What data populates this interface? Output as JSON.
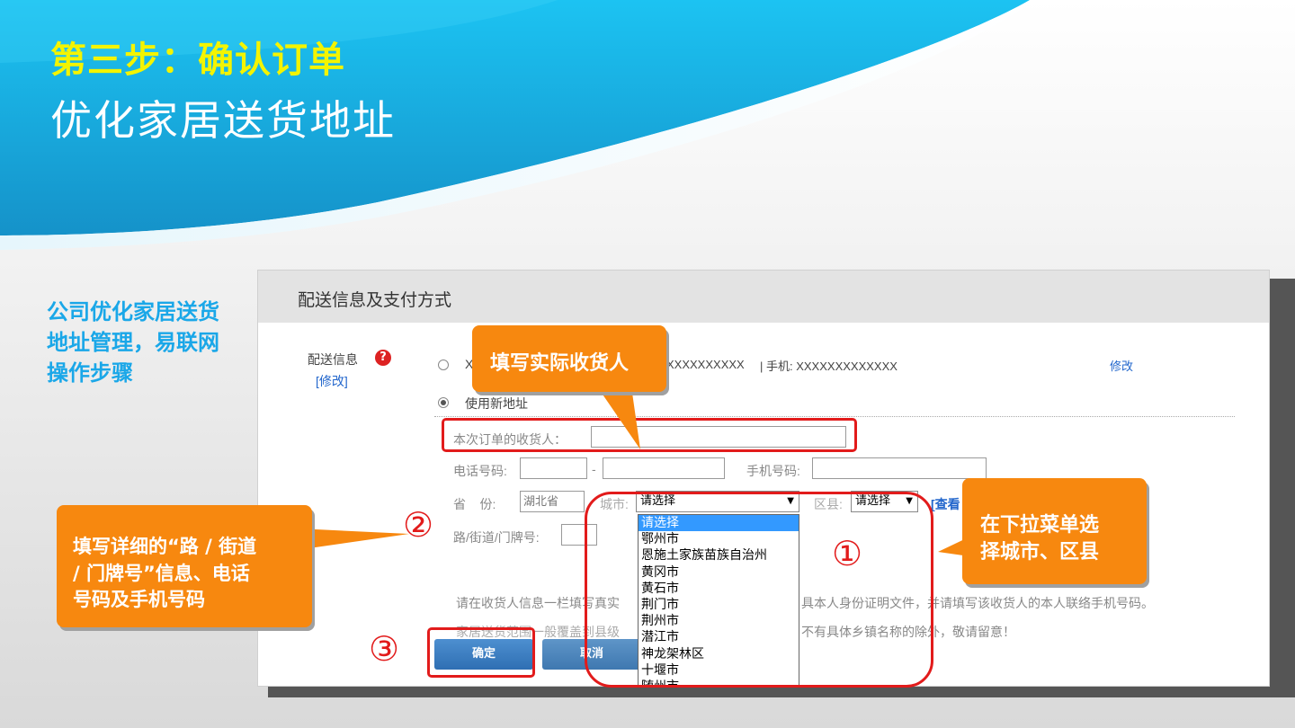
{
  "slide": {
    "step_title": "第三步：确认订单",
    "main_title": "优化家居送货地址",
    "side_note": "公司优化家居送货地址管理，易联网操作步骤"
  },
  "panel": {
    "title": "配送信息及支付方式",
    "delivery_label": "配送信息",
    "help_icon": "?",
    "edit_link_1": "[修改]",
    "saved_address_line": "X",
    "saved_mask": "XXXXXXXXXX",
    "phone_text": "| 手机: XXXXXXXXXXXXX",
    "edit_link_2": "修改",
    "use_new_address": "使用新地址",
    "receiver_label": "本次订单的收货人：",
    "phone_label": "电话号码:",
    "phone_dash": "-",
    "mobile_label": "手机号码:",
    "province_label": "省    份:",
    "province_value": "湖北省",
    "city_label": "城市:",
    "city_value": "请选择",
    "district_label": "区县:",
    "district_value": "请选择",
    "view_link": "[查看",
    "street_label": "路/街道/门牌号:",
    "notice_1_a": "请在收货人信息一栏填写真实",
    "notice_1_b": "具本人身份证明文件，并请填写该收货人的本人联络手机号码。",
    "notice_2_a": "家居送货范围一般覆盖到县级",
    "notice_2_b": "不有具体乡镇名称的除外，敬请留意！",
    "confirm_button": "确定",
    "cancel_button": "取消"
  },
  "city_options": [
    "请选择",
    "鄂州市",
    "恩施土家族苗族自治州",
    "黄冈市",
    "黄石市",
    "荆门市",
    "荆州市",
    "潜江市",
    "神龙架林区",
    "十堰市",
    "随州市"
  ],
  "callouts": {
    "receiver": "填写实际收货人",
    "street_1": "填写详细的“路 / 街道",
    "street_2": "/ 门牌号”信息、电话",
    "street_3": "号码及手机号码",
    "city_1": "在下拉菜单选",
    "city_2": "择城市、区县"
  },
  "markers": {
    "one": "①",
    "two": "②",
    "three": "③"
  },
  "colors": {
    "title_yellow": "#f4f400",
    "accent_blue": "#1aa7e8",
    "callout_orange": "#f7880f",
    "highlight_red": "#e21b1b"
  }
}
